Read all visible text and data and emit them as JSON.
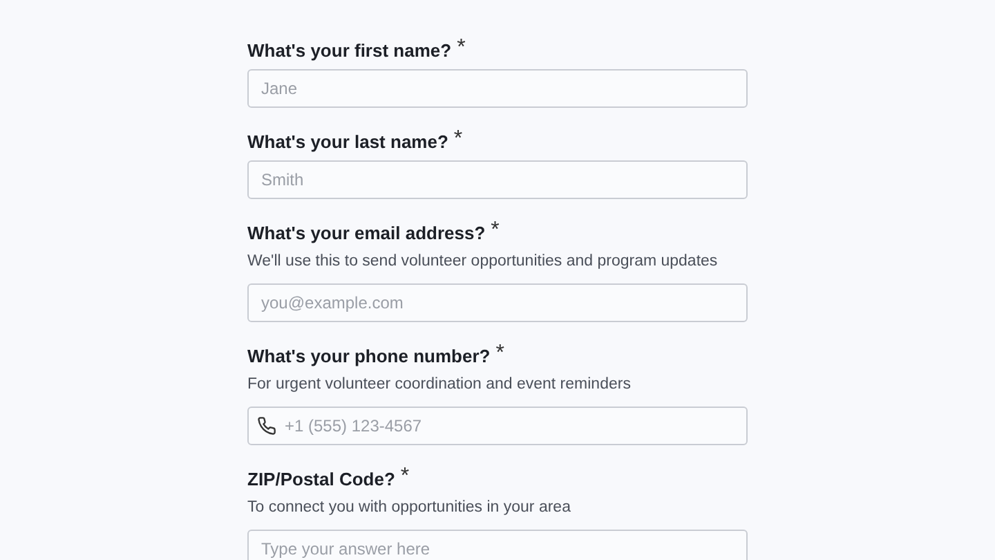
{
  "questions": [
    {
      "label": "What's your first name?",
      "required_mark": "*",
      "placeholder": "Jane",
      "kind": "text"
    },
    {
      "label": "What's your last name?",
      "required_mark": "*",
      "placeholder": "Smith",
      "kind": "text"
    },
    {
      "label": "What's your email address?",
      "required_mark": "*",
      "help": "We'll use this to send volunteer opportunities and program updates",
      "placeholder": "you@example.com",
      "kind": "text"
    },
    {
      "label": "What's your phone number?",
      "required_mark": "*",
      "help": "For urgent volunteer coordination and event reminders",
      "placeholder": "+1 (555) 123-4567",
      "kind": "phone"
    },
    {
      "label": "ZIP/Postal Code?",
      "required_mark": "*",
      "help": "To connect you with opportunities in your area",
      "placeholder": "Type your answer here",
      "kind": "text"
    }
  ]
}
